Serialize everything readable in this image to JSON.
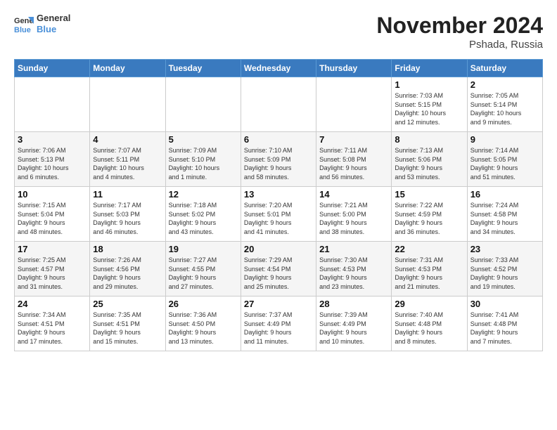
{
  "header": {
    "logo_line1": "General",
    "logo_line2": "Blue",
    "month": "November 2024",
    "location": "Pshada, Russia"
  },
  "weekdays": [
    "Sunday",
    "Monday",
    "Tuesday",
    "Wednesday",
    "Thursday",
    "Friday",
    "Saturday"
  ],
  "weeks": [
    [
      {
        "day": "",
        "info": ""
      },
      {
        "day": "",
        "info": ""
      },
      {
        "day": "",
        "info": ""
      },
      {
        "day": "",
        "info": ""
      },
      {
        "day": "",
        "info": ""
      },
      {
        "day": "1",
        "info": "Sunrise: 7:03 AM\nSunset: 5:15 PM\nDaylight: 10 hours\nand 12 minutes."
      },
      {
        "day": "2",
        "info": "Sunrise: 7:05 AM\nSunset: 5:14 PM\nDaylight: 10 hours\nand 9 minutes."
      }
    ],
    [
      {
        "day": "3",
        "info": "Sunrise: 7:06 AM\nSunset: 5:13 PM\nDaylight: 10 hours\nand 6 minutes."
      },
      {
        "day": "4",
        "info": "Sunrise: 7:07 AM\nSunset: 5:11 PM\nDaylight: 10 hours\nand 4 minutes."
      },
      {
        "day": "5",
        "info": "Sunrise: 7:09 AM\nSunset: 5:10 PM\nDaylight: 10 hours\nand 1 minute."
      },
      {
        "day": "6",
        "info": "Sunrise: 7:10 AM\nSunset: 5:09 PM\nDaylight: 9 hours\nand 58 minutes."
      },
      {
        "day": "7",
        "info": "Sunrise: 7:11 AM\nSunset: 5:08 PM\nDaylight: 9 hours\nand 56 minutes."
      },
      {
        "day": "8",
        "info": "Sunrise: 7:13 AM\nSunset: 5:06 PM\nDaylight: 9 hours\nand 53 minutes."
      },
      {
        "day": "9",
        "info": "Sunrise: 7:14 AM\nSunset: 5:05 PM\nDaylight: 9 hours\nand 51 minutes."
      }
    ],
    [
      {
        "day": "10",
        "info": "Sunrise: 7:15 AM\nSunset: 5:04 PM\nDaylight: 9 hours\nand 48 minutes."
      },
      {
        "day": "11",
        "info": "Sunrise: 7:17 AM\nSunset: 5:03 PM\nDaylight: 9 hours\nand 46 minutes."
      },
      {
        "day": "12",
        "info": "Sunrise: 7:18 AM\nSunset: 5:02 PM\nDaylight: 9 hours\nand 43 minutes."
      },
      {
        "day": "13",
        "info": "Sunrise: 7:20 AM\nSunset: 5:01 PM\nDaylight: 9 hours\nand 41 minutes."
      },
      {
        "day": "14",
        "info": "Sunrise: 7:21 AM\nSunset: 5:00 PM\nDaylight: 9 hours\nand 38 minutes."
      },
      {
        "day": "15",
        "info": "Sunrise: 7:22 AM\nSunset: 4:59 PM\nDaylight: 9 hours\nand 36 minutes."
      },
      {
        "day": "16",
        "info": "Sunrise: 7:24 AM\nSunset: 4:58 PM\nDaylight: 9 hours\nand 34 minutes."
      }
    ],
    [
      {
        "day": "17",
        "info": "Sunrise: 7:25 AM\nSunset: 4:57 PM\nDaylight: 9 hours\nand 31 minutes."
      },
      {
        "day": "18",
        "info": "Sunrise: 7:26 AM\nSunset: 4:56 PM\nDaylight: 9 hours\nand 29 minutes."
      },
      {
        "day": "19",
        "info": "Sunrise: 7:27 AM\nSunset: 4:55 PM\nDaylight: 9 hours\nand 27 minutes."
      },
      {
        "day": "20",
        "info": "Sunrise: 7:29 AM\nSunset: 4:54 PM\nDaylight: 9 hours\nand 25 minutes."
      },
      {
        "day": "21",
        "info": "Sunrise: 7:30 AM\nSunset: 4:53 PM\nDaylight: 9 hours\nand 23 minutes."
      },
      {
        "day": "22",
        "info": "Sunrise: 7:31 AM\nSunset: 4:53 PM\nDaylight: 9 hours\nand 21 minutes."
      },
      {
        "day": "23",
        "info": "Sunrise: 7:33 AM\nSunset: 4:52 PM\nDaylight: 9 hours\nand 19 minutes."
      }
    ],
    [
      {
        "day": "24",
        "info": "Sunrise: 7:34 AM\nSunset: 4:51 PM\nDaylight: 9 hours\nand 17 minutes."
      },
      {
        "day": "25",
        "info": "Sunrise: 7:35 AM\nSunset: 4:51 PM\nDaylight: 9 hours\nand 15 minutes."
      },
      {
        "day": "26",
        "info": "Sunrise: 7:36 AM\nSunset: 4:50 PM\nDaylight: 9 hours\nand 13 minutes."
      },
      {
        "day": "27",
        "info": "Sunrise: 7:37 AM\nSunset: 4:49 PM\nDaylight: 9 hours\nand 11 minutes."
      },
      {
        "day": "28",
        "info": "Sunrise: 7:39 AM\nSunset: 4:49 PM\nDaylight: 9 hours\nand 10 minutes."
      },
      {
        "day": "29",
        "info": "Sunrise: 7:40 AM\nSunset: 4:48 PM\nDaylight: 9 hours\nand 8 minutes."
      },
      {
        "day": "30",
        "info": "Sunrise: 7:41 AM\nSunset: 4:48 PM\nDaylight: 9 hours\nand 7 minutes."
      }
    ]
  ]
}
